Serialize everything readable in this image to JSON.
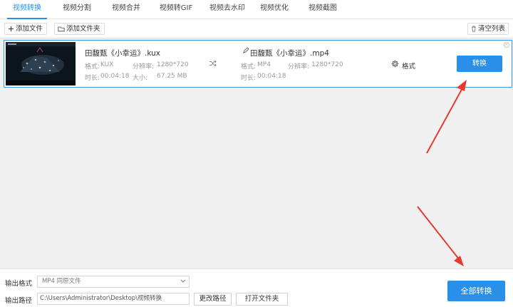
{
  "tabs": [
    {
      "label": "视频转换",
      "active": true
    },
    {
      "label": "视频分割"
    },
    {
      "label": "视频合并"
    },
    {
      "label": "视频转GIF"
    },
    {
      "label": "视频去水印"
    },
    {
      "label": "视频优化"
    },
    {
      "label": "视频截图"
    }
  ],
  "toolbar": {
    "add_file": "添加文件",
    "add_folder": "添加文件夹",
    "clear_list": "清空列表"
  },
  "file": {
    "source_name": "田馥甄《小幸运》.kux",
    "source_format_label": "格式:",
    "source_format": "KUX",
    "source_resolution_label": "分辨率:",
    "source_resolution": "1280*720",
    "source_duration_label": "时长:",
    "source_duration": "00:04:18",
    "source_size_label": "大小:",
    "source_size": "67.25 MB",
    "output_name": "田馥甄《小幸运》.mp4",
    "output_format_label": "格式:",
    "output_format": "MP4",
    "output_resolution_label": "分辨率:",
    "output_resolution": "1280*720",
    "output_duration_label": "时长:",
    "output_duration": "00:04:18",
    "format_settings": "格式",
    "convert_button": "转换"
  },
  "bottom": {
    "output_format_label": "输出格式",
    "output_format_value": "MP4  同原文件",
    "output_path_label": "输出路径",
    "output_path_value": "C:\\Users\\Administrator\\Desktop\\视频转换",
    "change_path": "更改路径",
    "open_folder": "打开文件夹",
    "convert_all": "全部转换"
  },
  "colors": {
    "accent": "#2a8fe8",
    "annotation_arrow": "#e8392f"
  },
  "icons": [
    "plus-icon",
    "folder-icon",
    "trash-icon",
    "close-icon",
    "shuffle-icon",
    "pencil-icon",
    "gear-icon",
    "chevron-down-icon"
  ]
}
